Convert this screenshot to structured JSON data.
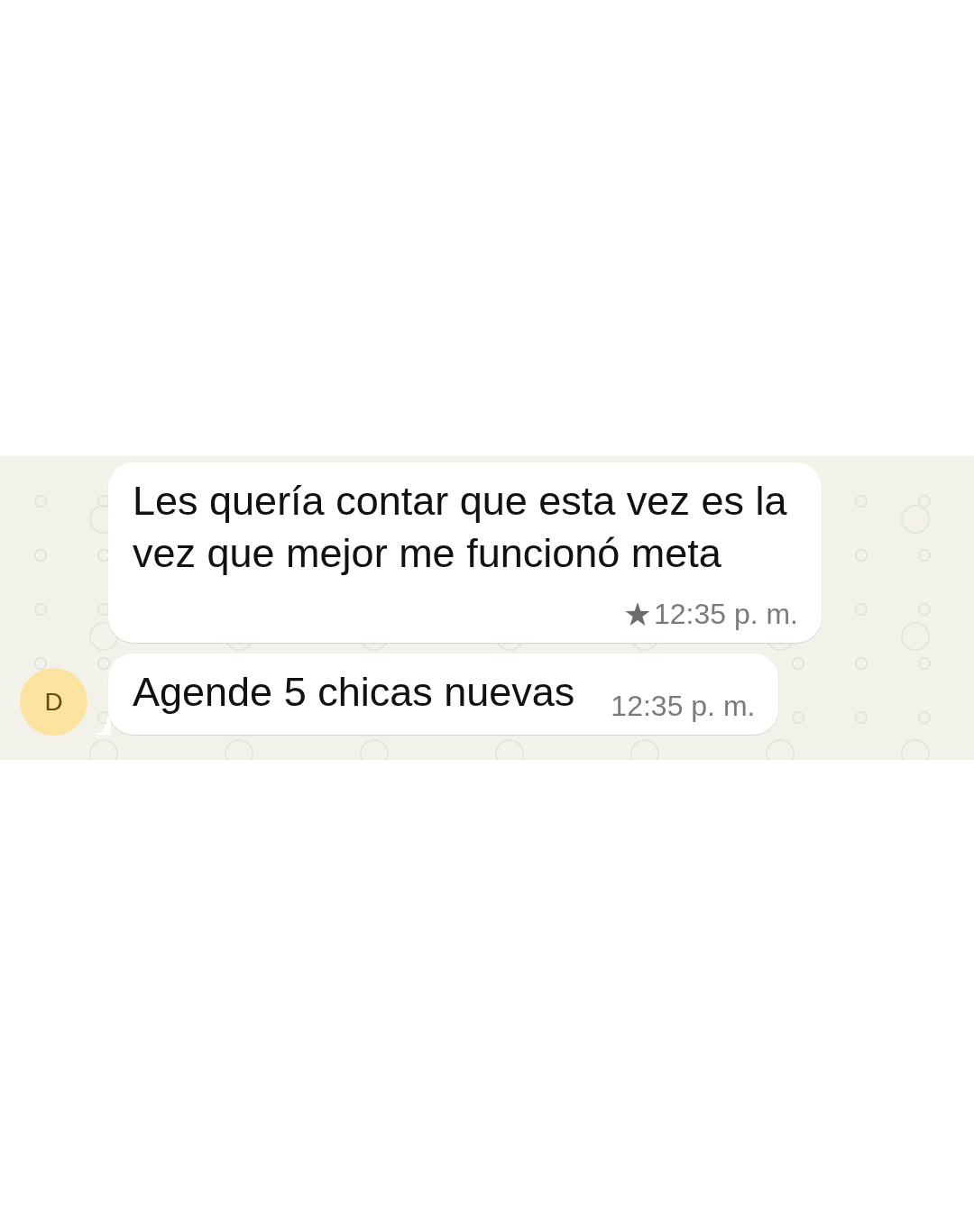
{
  "chat": {
    "messages": [
      {
        "text": "Les quería contar que esta vez es la vez que mejor me funcionó meta",
        "time": "12:35 p. m.",
        "starred": true,
        "tail": false
      },
      {
        "text": "Agende 5 chicas nuevas",
        "time": "12:35 p. m.",
        "starred": false,
        "tail": true
      }
    ],
    "sender_avatar": {
      "initial": "D"
    }
  }
}
